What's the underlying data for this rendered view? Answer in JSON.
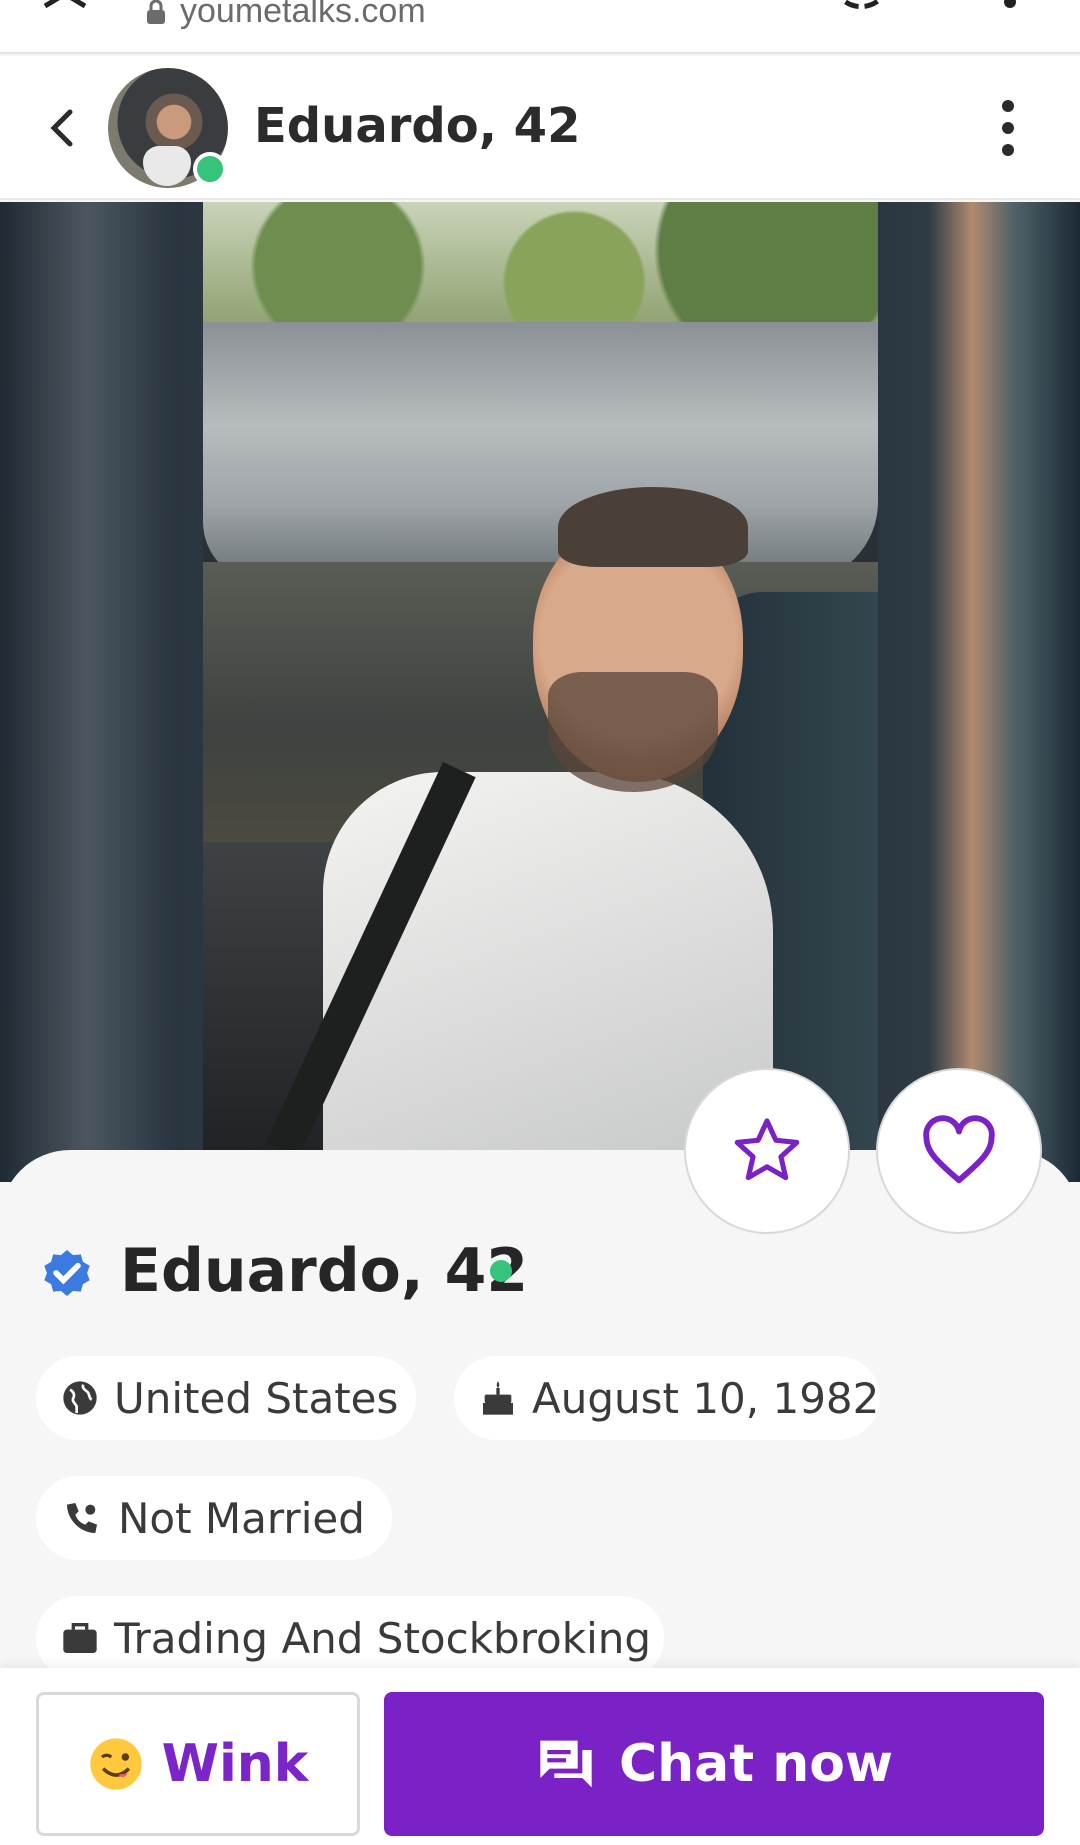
{
  "browser": {
    "url": "youmetalks.com"
  },
  "header": {
    "title": "Eduardo, 42"
  },
  "profile": {
    "name": "Eduardo, 42",
    "country": "United States",
    "birthday": "August 10, 1982",
    "marital_status": "Not Married",
    "occupation": "Trading And Stockbroking"
  },
  "actions": {
    "wink_label": "Wink",
    "chat_label": "Chat now"
  },
  "colors": {
    "accent": "#7b22c7",
    "online": "#35c47a",
    "verified": "#3b7be0"
  },
  "icons": [
    "back-icon",
    "more-vertical-icon",
    "star-icon",
    "heart-icon",
    "verified-icon",
    "globe-icon",
    "cake-icon",
    "phone-person-icon",
    "briefcase-icon",
    "wink-emoji-icon",
    "chat-icon",
    "lock-icon"
  ]
}
